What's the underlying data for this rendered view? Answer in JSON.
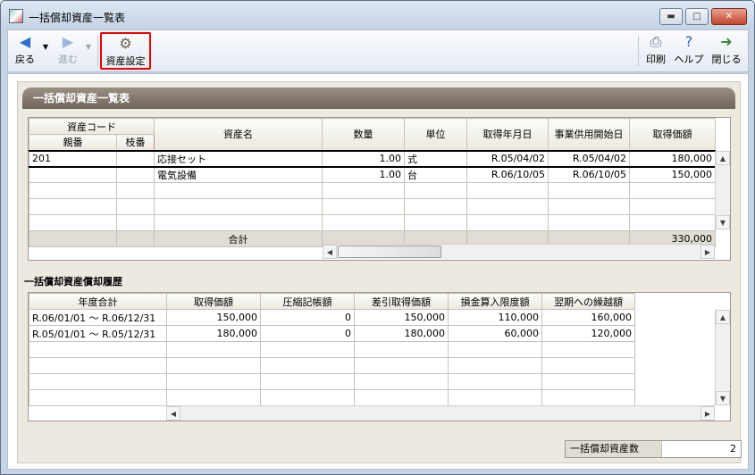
{
  "window": {
    "title": "一括償却資産一覧表",
    "min": "▬",
    "max": "□",
    "close": "✕"
  },
  "toolbar": {
    "back": "戻る",
    "forward": "進む",
    "asset_settings": "資産設定",
    "print": "印刷",
    "help": "ヘルプ",
    "close": "閉じる"
  },
  "panel_title": "一括償却資産一覧表",
  "table1": {
    "group_header": "資産コード",
    "sub_headers": [
      "親番",
      "枝番"
    ],
    "headers": [
      "資産名",
      "数量",
      "単位",
      "取得年月日",
      "事業供用開始日",
      "取得価額"
    ],
    "rows": [
      [
        "201",
        "",
        "応接セット",
        "1.00",
        "式",
        "R.05/04/02",
        "R.05/04/02",
        "180,000"
      ],
      [
        "",
        "",
        "電気設備",
        "1.00",
        "台",
        "R.06/10/05",
        "R.06/10/05",
        "150,000"
      ]
    ],
    "total_label": "合計",
    "total_value": "330,000"
  },
  "section2_title": "一括償却資産償却履歴",
  "table2": {
    "headers": [
      "年度合計",
      "取得価額",
      "圧縮記帳額",
      "差引取得価額",
      "損金算入限度額",
      "翌期への繰越額"
    ],
    "rows": [
      [
        "R.06/01/01 ～ R.06/12/31",
        "150,000",
        "0",
        "150,000",
        "110,000",
        "160,000"
      ],
      [
        "R.05/01/01 ～ R.05/12/31",
        "180,000",
        "0",
        "180,000",
        "60,000",
        "120,000"
      ]
    ]
  },
  "count": {
    "label": "一括償却資産数",
    "value": "2"
  },
  "colors": {
    "header_brown": "#7d7268",
    "panel_bg": "#ede9e1",
    "highlight_red": "#e00000"
  }
}
